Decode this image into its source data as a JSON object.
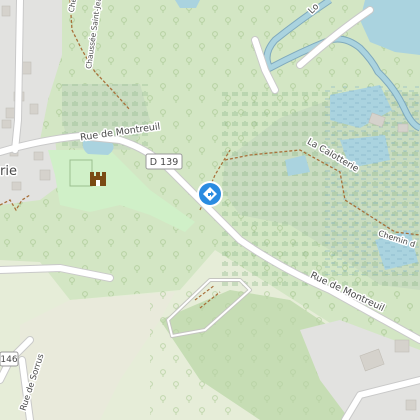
{
  "map": {
    "colors": {
      "forest": "#d3e6c4",
      "forest_dark": "#c6ddb4",
      "meadow": "#e6edd8",
      "wetland": "#c9dcc0",
      "park": "#d0f0c8",
      "water": "#aad3df",
      "road": "#ffffff",
      "road_casing": "#c9c9c9",
      "path": "#a8703a",
      "urban": "#e2e2e0",
      "marker": "#2a8be0"
    },
    "labels": {
      "road_main_west": "Rue de Montreuil",
      "road_main_east": "Rue de Montreuil",
      "road_ref": "D 139",
      "road_ref_sw": "146",
      "chaussee": "Chaussée Saint-Jean",
      "chemin_top": "Che",
      "river": "Lo",
      "locality": "La Calotterie",
      "chemin_east": "Chemin d",
      "sorrus": "Rue de Sorrus",
      "village_fragment": "rie"
    },
    "icons": {
      "poi": "castle-icon",
      "marker": "direction-marker-icon"
    }
  }
}
